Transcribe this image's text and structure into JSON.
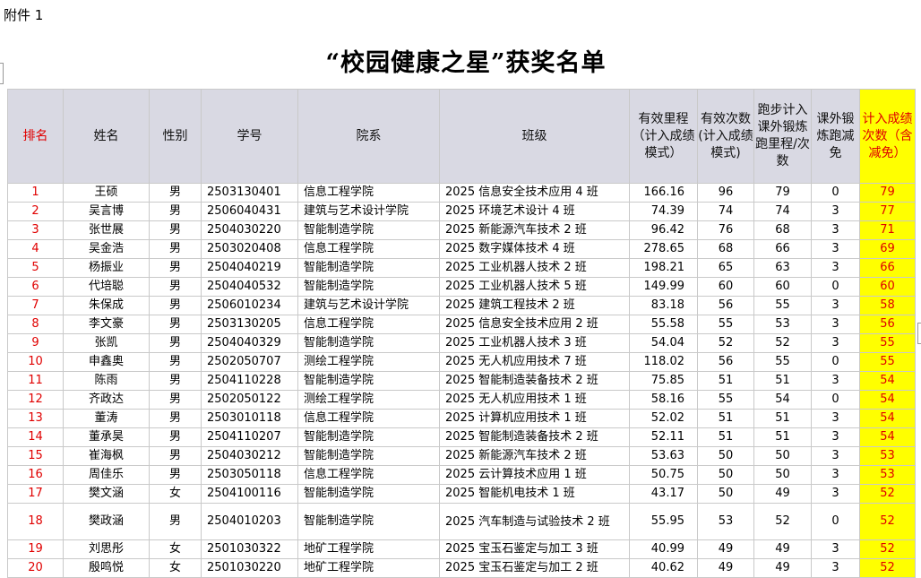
{
  "attachment_label": "附件 1",
  "title": "“校园健康之星”获奖名单",
  "headers": {
    "rank": "排名",
    "name": "姓名",
    "gender": "性别",
    "id": "学号",
    "college": "院系",
    "class": "班级",
    "mileage": "有效里程（计入成绩模式）",
    "count": "有效次数(计入成绩模式)",
    "run_to_extra": "跑步计入课外锻炼跑里程/次数",
    "extra_exempt": "课外锻炼跑减免",
    "score_count": "计入成绩次数（含减免）"
  },
  "rows": [
    {
      "rank": "1",
      "name": "王硕",
      "gender": "男",
      "id": "2503130401",
      "college": "信息工程学院",
      "class": "2025 信息安全技术应用 4 班",
      "mileage": "166.16",
      "count": "96",
      "run_to_extra": "79",
      "extra_exempt": "0",
      "score_count": "79"
    },
    {
      "rank": "2",
      "name": "吴言博",
      "gender": "男",
      "id": "2506040431",
      "college": "建筑与艺术设计学院",
      "class": "2025 环境艺术设计 4 班",
      "mileage": "74.39",
      "count": "74",
      "run_to_extra": "74",
      "extra_exempt": "3",
      "score_count": "77"
    },
    {
      "rank": "3",
      "name": "张世展",
      "gender": "男",
      "id": "2504030220",
      "college": "智能制造学院",
      "class": "2025 新能源汽车技术 2 班",
      "mileage": "96.42",
      "count": "76",
      "run_to_extra": "68",
      "extra_exempt": "3",
      "score_count": "71"
    },
    {
      "rank": "4",
      "name": "吴金浩",
      "gender": "男",
      "id": "2503020408",
      "college": "信息工程学院",
      "class": "2025 数字媒体技术 4 班",
      "mileage": "278.65",
      "count": "68",
      "run_to_extra": "66",
      "extra_exempt": "3",
      "score_count": "69"
    },
    {
      "rank": "5",
      "name": "杨振业",
      "gender": "男",
      "id": "2504040219",
      "college": "智能制造学院",
      "class": "2025 工业机器人技术 2 班",
      "mileage": "198.21",
      "count": "65",
      "run_to_extra": "63",
      "extra_exempt": "3",
      "score_count": "66"
    },
    {
      "rank": "6",
      "name": "代培聪",
      "gender": "男",
      "id": "2504040532",
      "college": "智能制造学院",
      "class": "2025 工业机器人技术 5 班",
      "mileage": "149.99",
      "count": "60",
      "run_to_extra": "60",
      "extra_exempt": "0",
      "score_count": "60"
    },
    {
      "rank": "7",
      "name": "朱保成",
      "gender": "男",
      "id": "2506010234",
      "college": "建筑与艺术设计学院",
      "class": "2025 建筑工程技术 2 班",
      "mileage": "83.18",
      "count": "56",
      "run_to_extra": "55",
      "extra_exempt": "3",
      "score_count": "58"
    },
    {
      "rank": "8",
      "name": "李文豪",
      "gender": "男",
      "id": "2503130205",
      "college": "信息工程学院",
      "class": "2025 信息安全技术应用 2 班",
      "mileage": "55.58",
      "count": "55",
      "run_to_extra": "53",
      "extra_exempt": "3",
      "score_count": "56"
    },
    {
      "rank": "9",
      "name": "张凯",
      "gender": "男",
      "id": "2504040329",
      "college": "智能制造学院",
      "class": "2025 工业机器人技术 3 班",
      "mileage": "54.04",
      "count": "52",
      "run_to_extra": "52",
      "extra_exempt": "3",
      "score_count": "55"
    },
    {
      "rank": "10",
      "name": "申鑫奥",
      "gender": "男",
      "id": "2502050707",
      "college": "测绘工程学院",
      "class": "2025 无人机应用技术 7 班",
      "mileage": "118.02",
      "count": "56",
      "run_to_extra": "55",
      "extra_exempt": "0",
      "score_count": "55"
    },
    {
      "rank": "11",
      "name": "陈雨",
      "gender": "男",
      "id": "2504110228",
      "college": "智能制造学院",
      "class": "2025 智能制造装备技术 2 班",
      "mileage": "75.85",
      "count": "51",
      "run_to_extra": "51",
      "extra_exempt": "3",
      "score_count": "54"
    },
    {
      "rank": "12",
      "name": "齐政达",
      "gender": "男",
      "id": "2502050122",
      "college": "测绘工程学院",
      "class": "2025 无人机应用技术 1 班",
      "mileage": "58.16",
      "count": "55",
      "run_to_extra": "54",
      "extra_exempt": "0",
      "score_count": "54"
    },
    {
      "rank": "13",
      "name": "董涛",
      "gender": "男",
      "id": "2503010118",
      "college": "信息工程学院",
      "class": "2025 计算机应用技术 1 班",
      "mileage": "52.02",
      "count": "51",
      "run_to_extra": "51",
      "extra_exempt": "3",
      "score_count": "54"
    },
    {
      "rank": "14",
      "name": "董承昊",
      "gender": "男",
      "id": "2504110207",
      "college": "智能制造学院",
      "class": "2025 智能制造装备技术 2 班",
      "mileage": "52.11",
      "count": "51",
      "run_to_extra": "51",
      "extra_exempt": "3",
      "score_count": "54"
    },
    {
      "rank": "15",
      "name": "崔海枫",
      "gender": "男",
      "id": "2504030212",
      "college": "智能制造学院",
      "class": "2025 新能源汽车技术 2 班",
      "mileage": "53.63",
      "count": "50",
      "run_to_extra": "50",
      "extra_exempt": "3",
      "score_count": "53"
    },
    {
      "rank": "16",
      "name": "周佳乐",
      "gender": "男",
      "id": "2503050118",
      "college": "信息工程学院",
      "class": "2025 云计算技术应用 1 班",
      "mileage": "50.75",
      "count": "50",
      "run_to_extra": "50",
      "extra_exempt": "3",
      "score_count": "53"
    },
    {
      "rank": "17",
      "name": "樊文涵",
      "gender": "女",
      "id": "2504100116",
      "college": "智能制造学院",
      "class": "2025 智能机电技术 1 班",
      "mileage": "43.17",
      "count": "50",
      "run_to_extra": "49",
      "extra_exempt": "3",
      "score_count": "52"
    },
    {
      "rank": "18",
      "name": "樊政涵",
      "gender": "男",
      "id": "2504010203",
      "college": "智能制造学院",
      "class": "2025 汽车制造与试验技术 2 班",
      "mileage": "55.95",
      "count": "53",
      "run_to_extra": "52",
      "extra_exempt": "0",
      "score_count": "52"
    },
    {
      "rank": "19",
      "name": "刘思彤",
      "gender": "女",
      "id": "2501030322",
      "college": "地矿工程学院",
      "class": "2025 宝玉石鉴定与加工 3 班",
      "mileage": "40.99",
      "count": "49",
      "run_to_extra": "49",
      "extra_exempt": "3",
      "score_count": "52"
    },
    {
      "rank": "20",
      "name": "殷鸣悦",
      "gender": "女",
      "id": "2501030220",
      "college": "地矿工程学院",
      "class": "2025 宝玉石鉴定与加工 2 班",
      "mileage": "40.62",
      "count": "49",
      "run_to_extra": "49",
      "extra_exempt": "3",
      "score_count": "52"
    }
  ]
}
